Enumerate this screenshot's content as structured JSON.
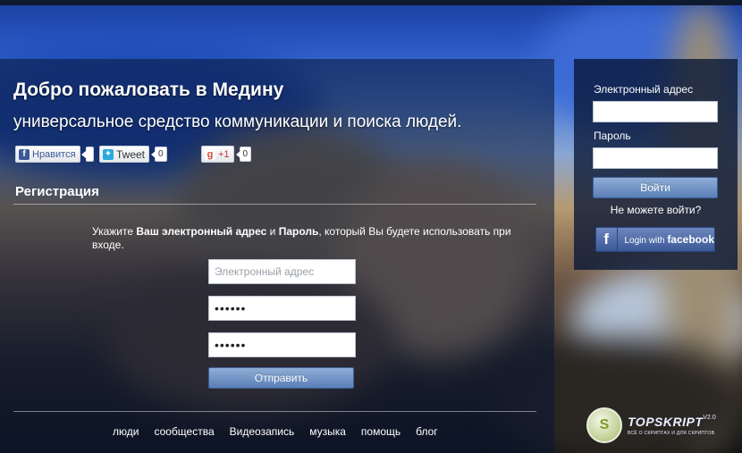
{
  "page": {
    "headline": "Добро пожаловать в Медину",
    "subheadline": "универсальное средство коммуникации и поиска людей."
  },
  "social": {
    "like_label": "Нравится",
    "tweet_label": "Tweet",
    "tweet_count": "0",
    "gplus_label": "+1",
    "gplus_count": "0"
  },
  "registration": {
    "title": "Регистрация",
    "instruction_prefix": "Укажите ",
    "instruction_email": "Ваш электронный адрес",
    "instruction_and": " и ",
    "instruction_password": "Пароль",
    "instruction_suffix": ", который Вы будете использовать при входе.",
    "email_placeholder": "Электронный адрес",
    "password_value": "••••••",
    "password_confirm_value": "••••••",
    "submit_label": "Отправить"
  },
  "footer": {
    "links": [
      "люди",
      "сообщества",
      "Видеозапись",
      "музыка",
      "помощь",
      "блог"
    ]
  },
  "login": {
    "email_label": "Электронный адрес",
    "password_label": "Пароль",
    "login_button": "Войти",
    "forgot_link": "Не можете войти?",
    "facebook_prefix": "Login with",
    "facebook_brand": "facebook"
  },
  "watermark": {
    "logo_letter": "S",
    "brand": "TOPSKRIPT",
    "version": "V2.0",
    "tagline": "ВСЁ О СКРИПТАХ И ДЛЯ СКРИПТОВ"
  },
  "colors": {
    "panel": "#081634",
    "button_blue": "#5a7fb7",
    "facebook_blue": "#3b5998"
  }
}
